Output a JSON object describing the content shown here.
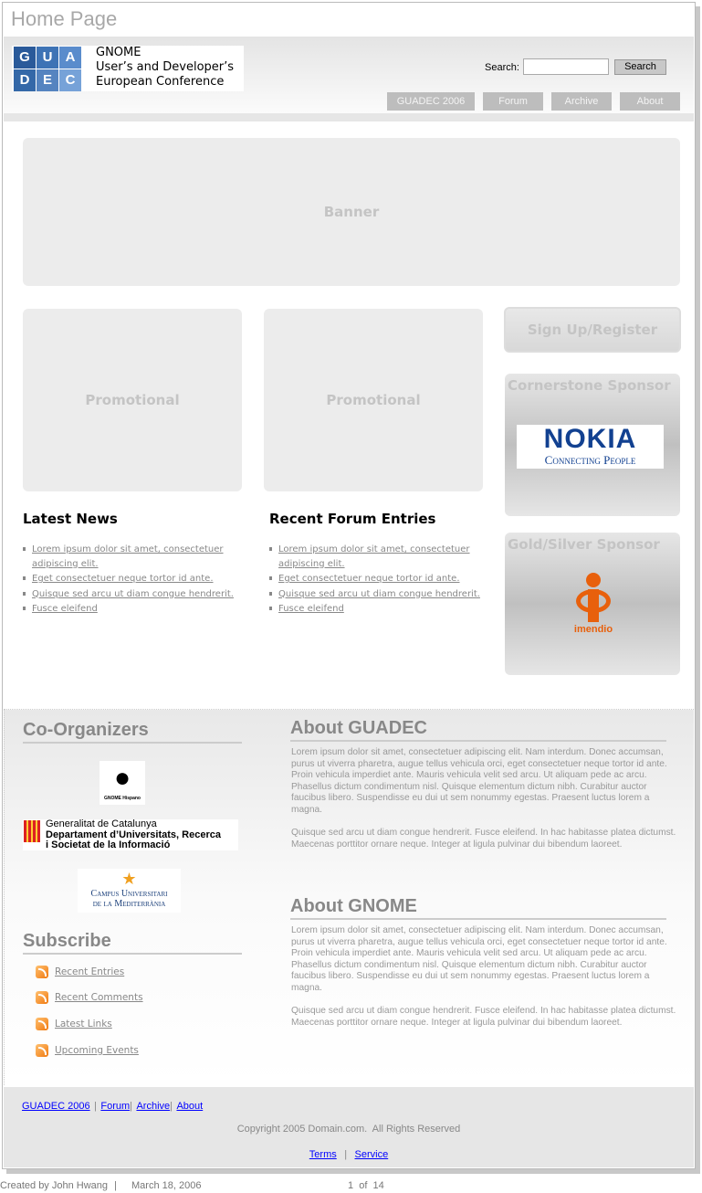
{
  "page_title": "Home Page",
  "logo": {
    "tiles": [
      "G",
      "U",
      "A",
      "D",
      "E",
      "C"
    ],
    "line1": "GNOME",
    "line2": "User’s and Developer’s",
    "line3": "European Conference"
  },
  "search": {
    "label": "Search:",
    "value": "",
    "button": "Search"
  },
  "nav": [
    "GUADEC 2006",
    "Forum",
    "Archive",
    "About"
  ],
  "banner": "Banner",
  "promos": [
    "Promotional",
    "Promotional"
  ],
  "signup": "Sign Up/Register",
  "sponsors": {
    "cornerstone": "Cornerstone Sponsor",
    "cornerstone_logo": "NOKIA",
    "cornerstone_tagline": "Connecting People",
    "gold": "Gold/Silver Sponsor",
    "gold_logo": "imendio"
  },
  "latest_news": {
    "title": "Latest News",
    "items": [
      "Lorem ipsum dolor sit amet, consectetuer adipiscing elit.",
      "Eget consectetuer neque tortor id ante.",
      "Quisque sed arcu ut diam congue hendrerit.",
      " Fusce eleifend"
    ]
  },
  "forum": {
    "title": "Recent Forum Entries",
    "items": [
      "Lorem ipsum dolor sit amet, consectetuer adipiscing elit.",
      "Eget consectetuer neque tortor id ante.",
      "Quisque sed arcu ut diam congue hendrerit.",
      " Fusce eleifend"
    ]
  },
  "coorganizers": {
    "title": "Co-Organizers",
    "gnome_hispano": "GNOME Hispano",
    "generalitat": [
      "Generalitat de Catalunya",
      "Departament d’Universitats, Recerca",
      "i Societat de la Informació"
    ],
    "campus": [
      "Campus Universitari",
      "de la Mediterrània"
    ]
  },
  "subscribe": {
    "title": "Subscribe",
    "items": [
      "Recent Entries",
      "Recent Comments",
      "Latest Links",
      "Upcoming Events"
    ]
  },
  "about_guadec": {
    "title": "About GUADEC",
    "p1": "Lorem ipsum dolor sit amet, consectetuer adipiscing elit. Nam interdum. Donec accumsan, purus ut viverra pharetra, augue tellus vehicula orci, eget consectetuer neque tortor id ante. Proin vehicula imperdiet ante. Mauris vehicula velit sed arcu. Ut aliquam pede ac arcu. Phasellus dictum condimentum nisl. Quisque elementum dictum nibh. Curabitur auctor faucibus libero. Suspendisse eu dui ut sem nonummy egestas. Praesent luctus lorem a magna.",
    "p2": "Quisque sed arcu ut diam congue hendrerit. Fusce eleifend. In hac habitasse platea dictumst. Maecenas porttitor ornare neque. Integer at ligula pulvinar dui bibendum laoreet."
  },
  "about_gnome": {
    "title": "About GNOME",
    "p1": "Lorem ipsum dolor sit amet, consectetuer adipiscing elit. Nam interdum. Donec accumsan, purus ut viverra pharetra, augue tellus vehicula orci, eget consectetuer neque tortor id ante. Proin vehicula imperdiet ante. Mauris vehicula velit sed arcu. Ut aliquam pede ac arcu. Phasellus dictum condimentum nisl. Quisque elementum dictum nibh. Curabitur auctor faucibus libero. Suspendisse eu dui ut sem nonummy egestas. Praesent luctus lorem a magna.",
    "p2": "Quisque sed arcu ut diam congue hendrerit. Fusce eleifend. In hac habitasse platea dictumst. Maecenas porttitor ornare neque. Integer at ligula pulvinar dui bibendum laoreet."
  },
  "footer": {
    "links": [
      "GUADEC 2006",
      "Forum",
      "Archive",
      "About"
    ],
    "copyright": "Copyright 2005 Domain.com.  All Rights Reserved",
    "terms": "Terms",
    "service": "Service",
    "sep": "|"
  },
  "meta": {
    "created_by": "Created by John Hwang",
    "sep": "|",
    "date": "March 18, 2006",
    "page": "1  of  14"
  },
  "colors": {
    "link": "#0000ff",
    "rss": "#f07a10",
    "nokia": "#124191",
    "imendio": "#e8600c"
  }
}
